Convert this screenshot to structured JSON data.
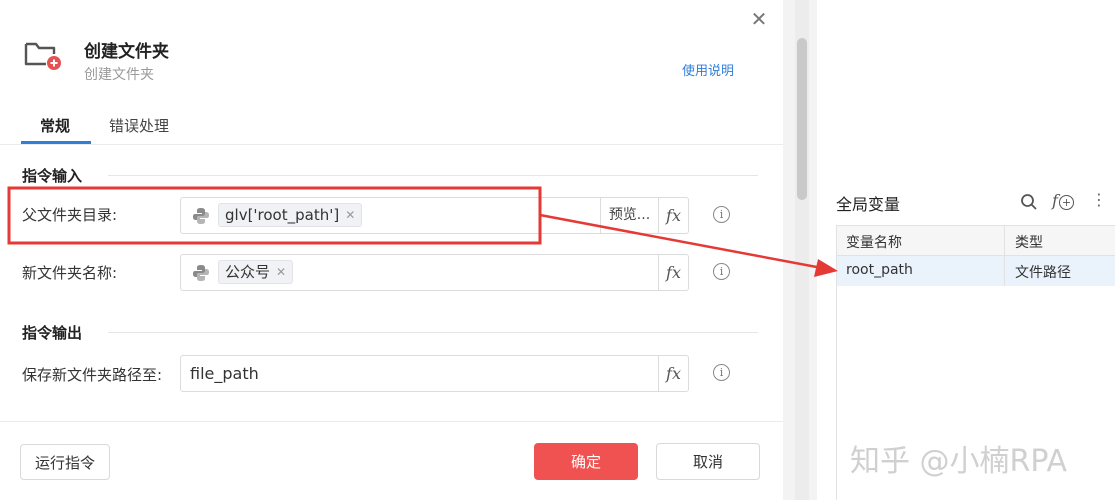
{
  "dialog": {
    "title": "创建文件夹",
    "subtitle": "创建文件夹",
    "help_link": "使用说明",
    "tabs": [
      {
        "label": "常规",
        "active": true
      },
      {
        "label": "错误处理",
        "active": false
      }
    ],
    "input_section": "指令输入",
    "output_section": "指令输出",
    "fields": {
      "parent_dir": {
        "label": "父文件夹目录:",
        "chip": "glv['root_path']",
        "preview": "预览..."
      },
      "new_name": {
        "label": "新文件夹名称:",
        "chip": "公众号"
      },
      "save_to": {
        "label": "保存新文件夹路径至:",
        "value": "file_path"
      }
    },
    "fx_label": "fx",
    "info_label": "i",
    "buttons": {
      "run": "运行指令",
      "ok": "确定",
      "cancel": "取消"
    }
  },
  "global_vars": {
    "title": "全局变量",
    "columns": [
      "变量名称",
      "类型"
    ],
    "rows": [
      {
        "name": "root_path",
        "type": "文件路径"
      }
    ]
  },
  "watermark": "知乎 @小楠RPA",
  "colors": {
    "accent": "#2f7ed8",
    "primary_button": "#f05252",
    "annotation": "#e53935",
    "selected_row": "#eaf2fc"
  }
}
